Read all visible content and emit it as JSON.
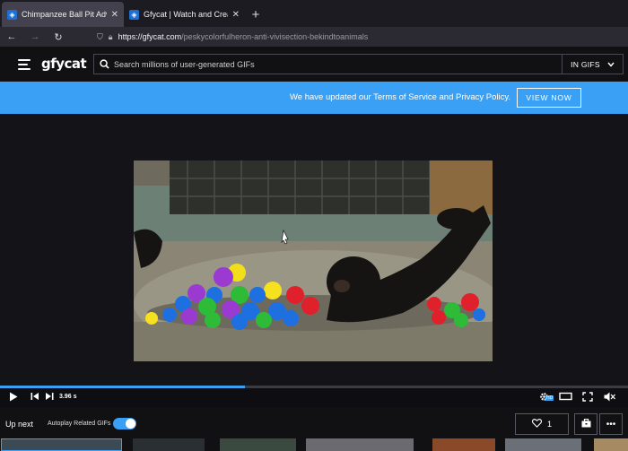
{
  "browser": {
    "tabs": [
      {
        "title": "Chimpanzee Ball Pit Adventure",
        "favicon": "gfycat-shield",
        "active": true
      },
      {
        "title": "Gfycat | Watch and Create GIFs",
        "favicon": "gfycat-shield",
        "active": false
      }
    ],
    "url_host": "https://gfycat.com",
    "url_path": "/peskycolorfulheron-anti-vivisection-bekindtoanimals"
  },
  "site": {
    "logo": "gfycat",
    "search_placeholder": "Search millions of user-generated GIFs",
    "search_scope": "IN GIFS"
  },
  "banner": {
    "message": "We have updated our Terms of Service and Privacy Policy.",
    "button": "VIEW NOW"
  },
  "player": {
    "progress_fraction": 0.39,
    "time": "3.96 s",
    "hd_badge": "HD",
    "accent": "#3aa0f5"
  },
  "footer": {
    "up_next": "Up next",
    "autoplay_label": "Autoplay Related GIFs",
    "autoplay_on": true,
    "likes": "1"
  }
}
